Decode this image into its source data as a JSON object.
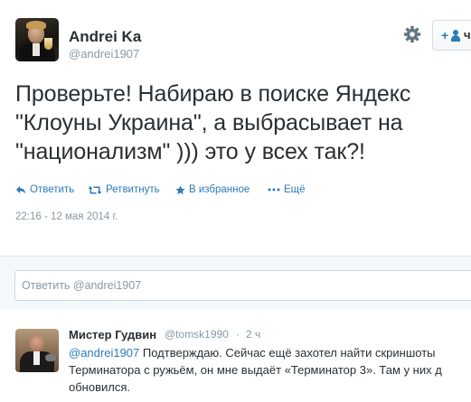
{
  "tweet": {
    "author_name": "Andrei Ka",
    "author_handle": "@andrei1907",
    "text": "Проверьте! Набираю в поиске Яндекс \"Клоуны Украина\", а выбрасывает на \"национализм\" ))) это у всех так?!",
    "actions": {
      "reply": "Ответить",
      "retweet": "Ретвитнуть",
      "favorite": "В избранное",
      "more": "Ещё"
    },
    "timestamp": "22:16 - 12 мая 2014 г.",
    "follow_button_glyph": "+",
    "follow_button_letter": "ч"
  },
  "reply_box": {
    "placeholder": "Ответить @andrei1907"
  },
  "reply_tweet": {
    "author_name": "Мистер Гудвин",
    "author_handle": "@tomsk1990",
    "separator": "·",
    "time": "2 ч",
    "mention": "@andrei1907",
    "line1_rest": " Подтверждаю. Сейчас ещё захотел найти скриншоты",
    "line2": "Терминатора с ружьём, он мне выдаёт «Терминатор 3». Там у них д",
    "line3": "обновился."
  },
  "icons": {
    "gear": "gear-icon",
    "follow": "follow-person-icon",
    "reply": "reply-arrow-icon",
    "retweet": "retweet-icon",
    "favorite": "star-icon",
    "more": "more-dots-icon"
  },
  "colors": {
    "link": "#2b7bb9",
    "muted": "#8899a6",
    "text": "#292f33",
    "reply_bg": "#f5f8fa"
  }
}
